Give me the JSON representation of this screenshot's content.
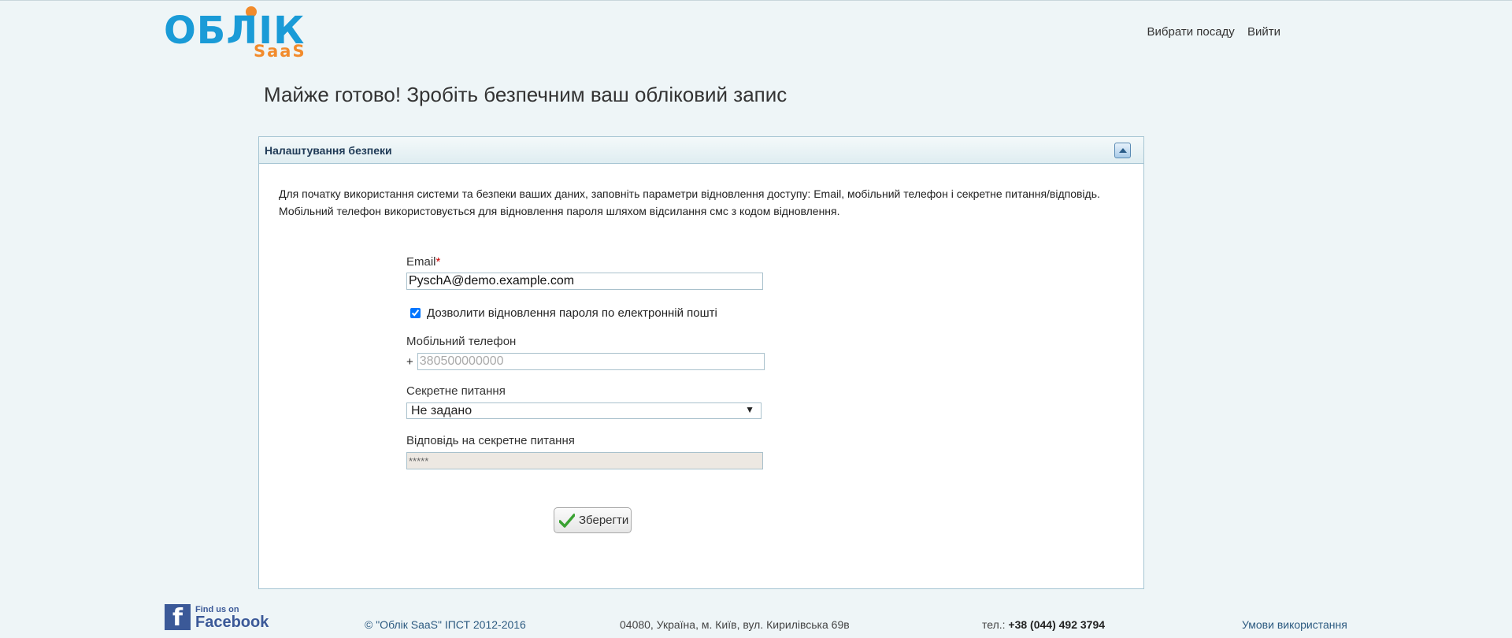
{
  "header": {
    "logo_main": "ОБЛІК",
    "logo_sub": "SaaS",
    "nav": {
      "choose_position": "Вибрати посаду",
      "logout": "Вийти"
    }
  },
  "page_title": "Майже готово! Зробіть безпечним ваш обліковий запис",
  "panel": {
    "title": "Налаштування безпеки",
    "intro_line1": "Для початку використання системи та безпеки ваших даних, заповніть параметри відновлення доступу: Email, мобільний телефон і секретне питання/відповідь.",
    "intro_line2": "Мобільний телефон використовується для відновлення пароля шляхом відсилання смс з кодом відновлення."
  },
  "form": {
    "email_label": "Email",
    "email_required_mark": "*",
    "email_value": "PyschA@demo.example.com",
    "allow_email_recovery_label": "Дозволити відновлення пароля по електронній пошті",
    "allow_email_recovery_checked": true,
    "phone_label": "Мобільний телефон",
    "phone_prefix": "+",
    "phone_placeholder": "380500000000",
    "question_label": "Секретне питання",
    "question_selected": "Не задано",
    "answer_label": "Відповідь на секретне питання",
    "answer_value": "*****",
    "save_label": "Зберегти"
  },
  "footer": {
    "fb_small": "Find us on",
    "fb_big": "Facebook",
    "copyright": "© \"Облік SaaS\" ІПСТ 2012-2016",
    "address": "04080, Україна, м. Київ, вул. Кирилівська 69в",
    "phone_prefix": "тел.: ",
    "phone": "+38 (044) 492 3794",
    "terms": "Умови використання"
  },
  "colors": {
    "background": "#eef5f7",
    "logo_blue": "#1a9bd7",
    "logo_orange": "#f28b2c",
    "panel_border": "#a6c5d3",
    "link": "#2c5a80"
  },
  "icons": {
    "collapse": "chevron-up-icon",
    "save": "checkmark-icon",
    "select_arrow": "triangle-down-icon",
    "facebook": "facebook-icon"
  }
}
